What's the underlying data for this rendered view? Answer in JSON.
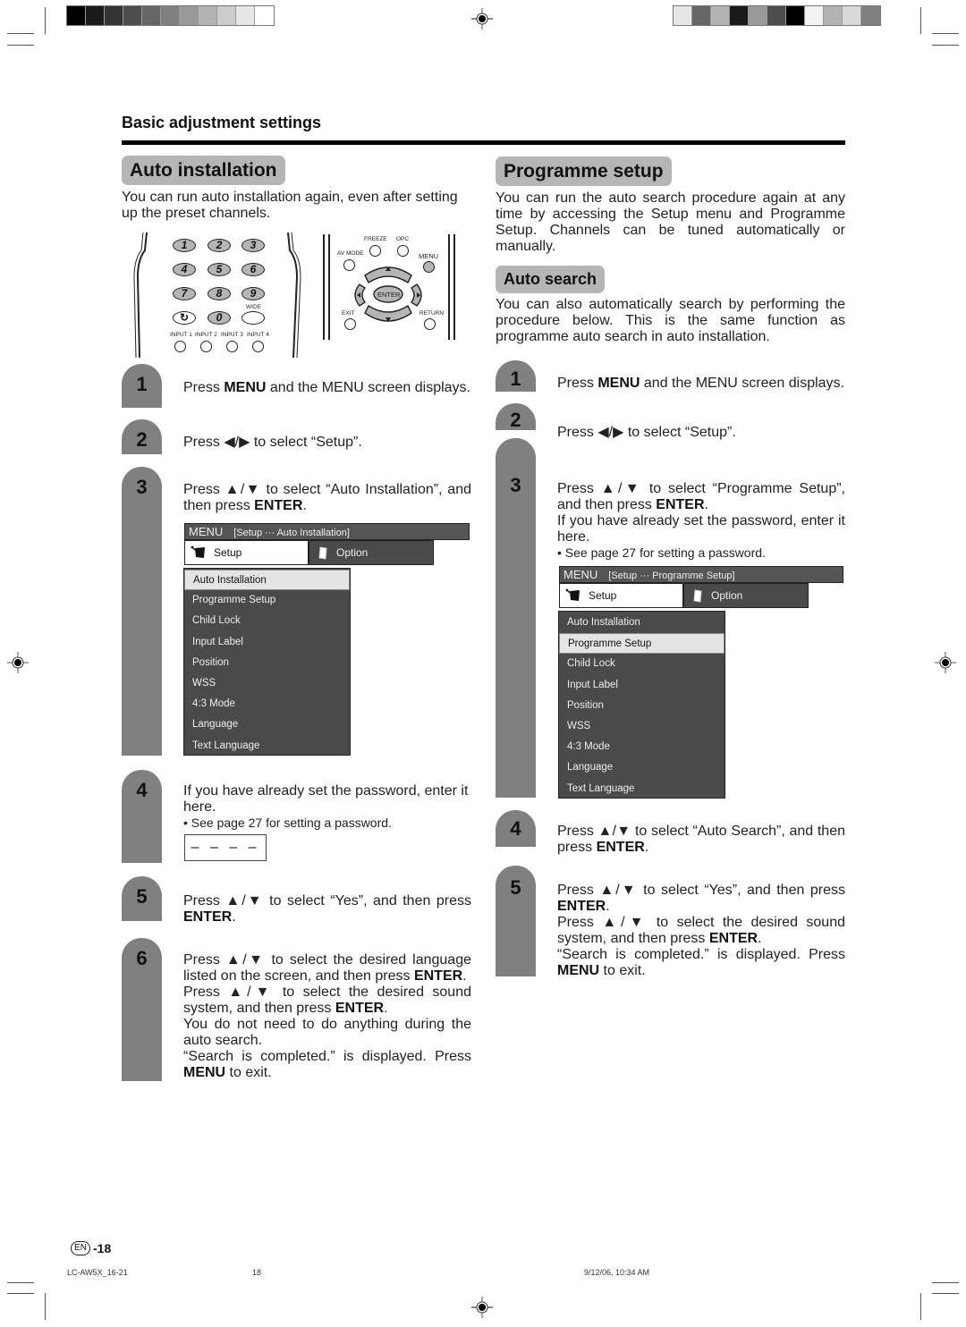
{
  "print_marks": {
    "left_swatches": [
      "#000000",
      "#1a1a1a",
      "#333333",
      "#4d4d4d",
      "#666666",
      "#808080",
      "#999999",
      "#b3b3b3",
      "#cccccc",
      "#e6e6e6",
      "#ffffff"
    ],
    "right_swatches": [
      "#e6e6e6",
      "#666666",
      "#b3b3b3",
      "#1a1a1a",
      "#999999",
      "#4d4d4d",
      "#000000",
      "#f2f2f2",
      "#b3b3b3",
      "#d9d9d9",
      "#808080"
    ]
  },
  "header": {
    "section_title": "Basic adjustment settings"
  },
  "left": {
    "title": "Auto installation",
    "intro": "You can run auto installation again, even after setting up the preset channels.",
    "remote": {
      "number_keys": [
        "1",
        "2",
        "3",
        "4",
        "5",
        "6",
        "7",
        "8",
        "9",
        "↻",
        "0",
        ""
      ],
      "wide_label": "WIDE",
      "input_labels": [
        "INPUT 1",
        "INPUT 2",
        "INPUT 3",
        "INPUT 4"
      ],
      "freeze_label": "FREEZE",
      "opc_label": "OPC",
      "av_mode_label": "AV MODE",
      "menu_label": "MENU",
      "enter_label": "ENTER",
      "exit_label": "EXIT",
      "return_label": "RETURN"
    },
    "steps": [
      {
        "num": "1",
        "pre": "Press ",
        "b1": "MENU",
        "post": " and the MENU screen displays."
      },
      {
        "num": "2",
        "text": "Press ◀/▶ to select “Setup”."
      },
      {
        "num": "3",
        "pre": "Press ▲/▼ to select “Auto Installation”, and then press ",
        "b1": "ENTER",
        "post": "."
      },
      {
        "num": "4",
        "text": "If you have already set the password, enter it here.",
        "note": "• See page 27 for setting a password.",
        "password_placeholder": "– – – –"
      },
      {
        "num": "5",
        "pre": "Press ▲/▼ to select “Yes”, and then press ",
        "b1": "ENTER",
        "post": "."
      },
      {
        "num": "6",
        "l1_pre": "Press ▲/▼ to select the desired language listed on the screen, and then press ",
        "l1_b": "ENTER",
        "l1_post": ".",
        "l2_pre": "Press ▲/▼ to select the desired sound system, and then press ",
        "l2_b": "ENTER",
        "l2_post": ".",
        "l3": "You do not need to do anything during the auto search.",
        "l4_pre": "“Search is completed.” is displayed. Press ",
        "l4_b": "MENU",
        "l4_post": " to exit."
      }
    ],
    "menu": {
      "menu_label": "MENU",
      "breadcrumb": "[Setup ··· Auto Installation]",
      "tabs": [
        "Setup",
        "Option"
      ],
      "items": [
        "Auto Installation",
        "Programme Setup",
        "Child Lock",
        "Input Label",
        "Position",
        "WSS",
        "4:3 Mode",
        "Language",
        "Text Language"
      ],
      "selected": "Auto Installation"
    }
  },
  "right": {
    "title": "Programme setup",
    "intro": "You can run the auto search procedure again at any time by accessing the Setup menu and Programme Setup. Channels can be tuned automatically or manually.",
    "subtitle": "Auto search",
    "sub_intro": "You can also automatically search by performing the procedure below. This is the same function as programme auto search in auto installation.",
    "steps": [
      {
        "num": "1",
        "pre": "Press ",
        "b1": "MENU",
        "post": " and the MENU screen displays."
      },
      {
        "num": "2",
        "text": "Press ◀/▶ to select “Setup”."
      },
      {
        "num": "3",
        "pre": "Press ▲/▼ to select “Programme Setup”, and then press ",
        "b1": "ENTER",
        "post": ".",
        "l2": "If you have already set the password, enter it here.",
        "note": "• See page 27 for setting a password."
      },
      {
        "num": "4",
        "pre": "Press ▲/▼ to select “Auto Search”, and then press ",
        "b1": "ENTER",
        "post": "."
      },
      {
        "num": "5",
        "l1_pre": "Press ▲/▼ to select “Yes”, and then press ",
        "l1_b": "ENTER",
        "l1_post": ".",
        "l2_pre": "Press ▲/▼ to select the desired sound system, and then press ",
        "l2_b": "ENTER",
        "l2_post": ".",
        "l3_pre": "“Search is completed.” is displayed. Press ",
        "l3_b": "MENU",
        "l3_post": " to exit."
      }
    ],
    "menu": {
      "menu_label": "MENU",
      "breadcrumb": "[Setup ··· Programme Setup]",
      "tabs": [
        "Setup",
        "Option"
      ],
      "items": [
        "Auto Installation",
        "Programme Setup",
        "Child Lock",
        "Input Label",
        "Position",
        "WSS",
        "4:3 Mode",
        "Language",
        "Text Language"
      ],
      "selected": "Programme Setup"
    }
  },
  "footer": {
    "lang_badge": "EN",
    "page_number": "-18",
    "file_name": "LC-AW5X_16-21",
    "sheet_number": "18",
    "timestamp": "9/12/06, 10:34 AM"
  }
}
